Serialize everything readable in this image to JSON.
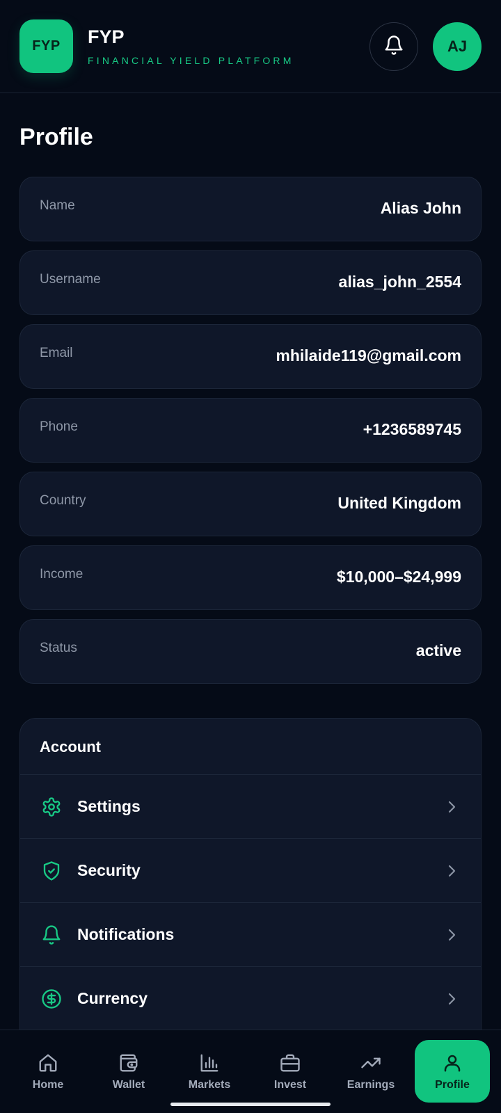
{
  "header": {
    "logo_text": "FYP",
    "brand_title": "FYP",
    "brand_subtitle": "FINANCIAL YIELD PLATFORM",
    "notification_icon": "bell-icon",
    "avatar_initials": "AJ"
  },
  "page": {
    "title": "Profile"
  },
  "profile_fields": [
    {
      "label": "Name",
      "value": "Alias John"
    },
    {
      "label": "Username",
      "value": "alias_john_2554"
    },
    {
      "label": "Email",
      "value": "mhilaide119@gmail.com"
    },
    {
      "label": "Phone",
      "value": "+1236589745"
    },
    {
      "label": "Country",
      "value": "United Kingdom"
    },
    {
      "label": "Income",
      "value": "$10,000–$24,999"
    },
    {
      "label": "Status",
      "value": "active"
    }
  ],
  "account": {
    "title": "Account",
    "items": [
      {
        "label": "Settings",
        "icon": "gear-icon"
      },
      {
        "label": "Security",
        "icon": "shield-check-icon"
      },
      {
        "label": "Notifications",
        "icon": "bell-icon"
      },
      {
        "label": "Currency",
        "icon": "dollar-circle-icon"
      }
    ]
  },
  "bottom_nav": {
    "items": [
      {
        "label": "Home",
        "icon": "home-icon"
      },
      {
        "label": "Wallet",
        "icon": "wallet-icon"
      },
      {
        "label": "Markets",
        "icon": "bar-chart-icon"
      },
      {
        "label": "Invest",
        "icon": "briefcase-icon"
      },
      {
        "label": "Earnings",
        "icon": "trending-up-icon"
      },
      {
        "label": "Profile",
        "icon": "user-icon"
      }
    ],
    "active": "Profile"
  },
  "colors": {
    "accent": "#11c47f",
    "background": "#050b17",
    "card": "#0f1729",
    "label": "#8f98a8"
  }
}
